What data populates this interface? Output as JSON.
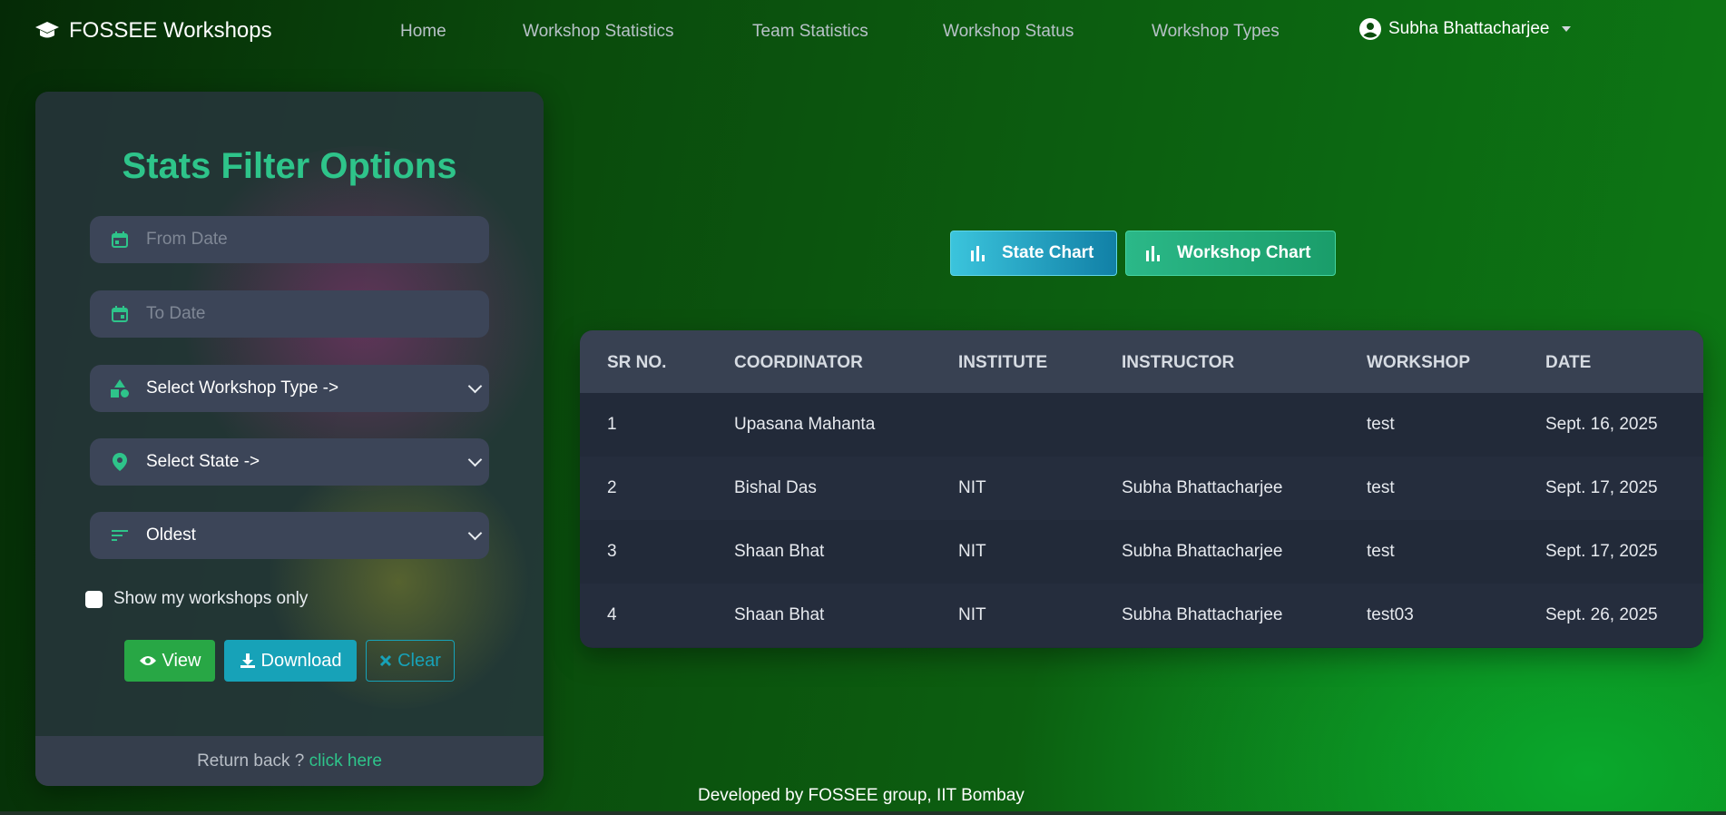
{
  "nav": {
    "brand": "FOSSEE Workshops",
    "links": [
      "Home",
      "Workshop Statistics",
      "Team Statistics",
      "Workshop Status",
      "Workshop Types"
    ],
    "user": "Subha Bhattacharjee"
  },
  "filter": {
    "title": "Stats Filter Options",
    "from_date_placeholder": "From Date",
    "to_date_placeholder": "To Date",
    "workshop_type": "Select Workshop Type ->",
    "state": "Select State ->",
    "sort": "Oldest",
    "checkbox_label": "Show my workshops only",
    "view_label": "View",
    "download_label": "Download",
    "clear_label": "Clear",
    "return_text": "Return back ?",
    "return_link": "click here"
  },
  "charts": {
    "state_chart_label": "State Chart",
    "workshop_chart_label": "Workshop Chart"
  },
  "table": {
    "headers": [
      "SR NO.",
      "COORDINATOR",
      "INSTITUTE",
      "INSTRUCTOR",
      "WORKSHOP",
      "DATE"
    ],
    "rows": [
      [
        "1",
        "Upasana Mahanta",
        "",
        "",
        "test",
        "Sept. 16, 2025"
      ],
      [
        "2",
        "Bishal Das",
        "NIT",
        "Subha Bhattacharjee",
        "test",
        "Sept. 17, 2025"
      ],
      [
        "3",
        "Shaan Bhat",
        "NIT",
        "Subha Bhattacharjee",
        "test",
        "Sept. 17, 2025"
      ],
      [
        "4",
        "Shaan Bhat",
        "NIT",
        "Subha Bhattacharjee",
        "test03",
        "Sept. 26, 2025"
      ]
    ]
  },
  "footer": "Developed by FOSSEE group, IIT Bombay",
  "colors": {
    "accent": "#2ec48a",
    "view": "#28a745",
    "download": "#17a2b8"
  }
}
